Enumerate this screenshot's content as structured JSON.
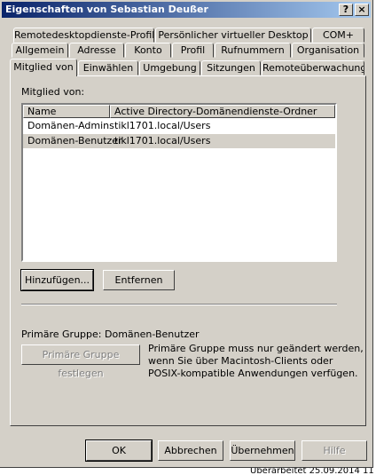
{
  "window": {
    "title": "Eigenschaften von Sebastian Deußer",
    "help_label": "?",
    "close_label": "×"
  },
  "tabs_row1": [
    "Remotedesktopdienste-Profil",
    "Persönlicher virtueller Desktop",
    "COM+"
  ],
  "tabs_row2": [
    "Allgemein",
    "Adresse",
    "Konto",
    "Profil",
    "Rufnummern",
    "Organisation"
  ],
  "tabs_row3": [
    "Mitglied von",
    "Einwählen",
    "Umgebung",
    "Sitzungen",
    "Remoteüberwachung"
  ],
  "members": {
    "label": "Mitglied von:",
    "col_name": "Name",
    "col_folder": "Active Directory-Domänendienste-Ordner",
    "rows": [
      {
        "name": "Domänen-Admins",
        "folder": "tikl1701.local/Users",
        "selected": false
      },
      {
        "name": "Domänen-Benutzer",
        "folder": "tikl1701.local/Users",
        "selected": true
      }
    ],
    "add_label": "Hinzufügen...",
    "remove_label": "Entfernen"
  },
  "primary": {
    "label": "Primäre Gruppe:",
    "value": "Domänen-Benutzer",
    "set_label": "Primäre Gruppe festlegen",
    "note_lines": [
      "Primäre Gruppe muss nur geändert werden,",
      "wenn Sie über Macintosh-Clients oder",
      "POSIX-kompatible Anwendungen verfügen."
    ]
  },
  "footer": {
    "ok": "OK",
    "cancel": "Abbrechen",
    "apply": "Übernehmen",
    "help": "Hilfe"
  },
  "background_text": "Überarbeitet 25.09.2014 11"
}
